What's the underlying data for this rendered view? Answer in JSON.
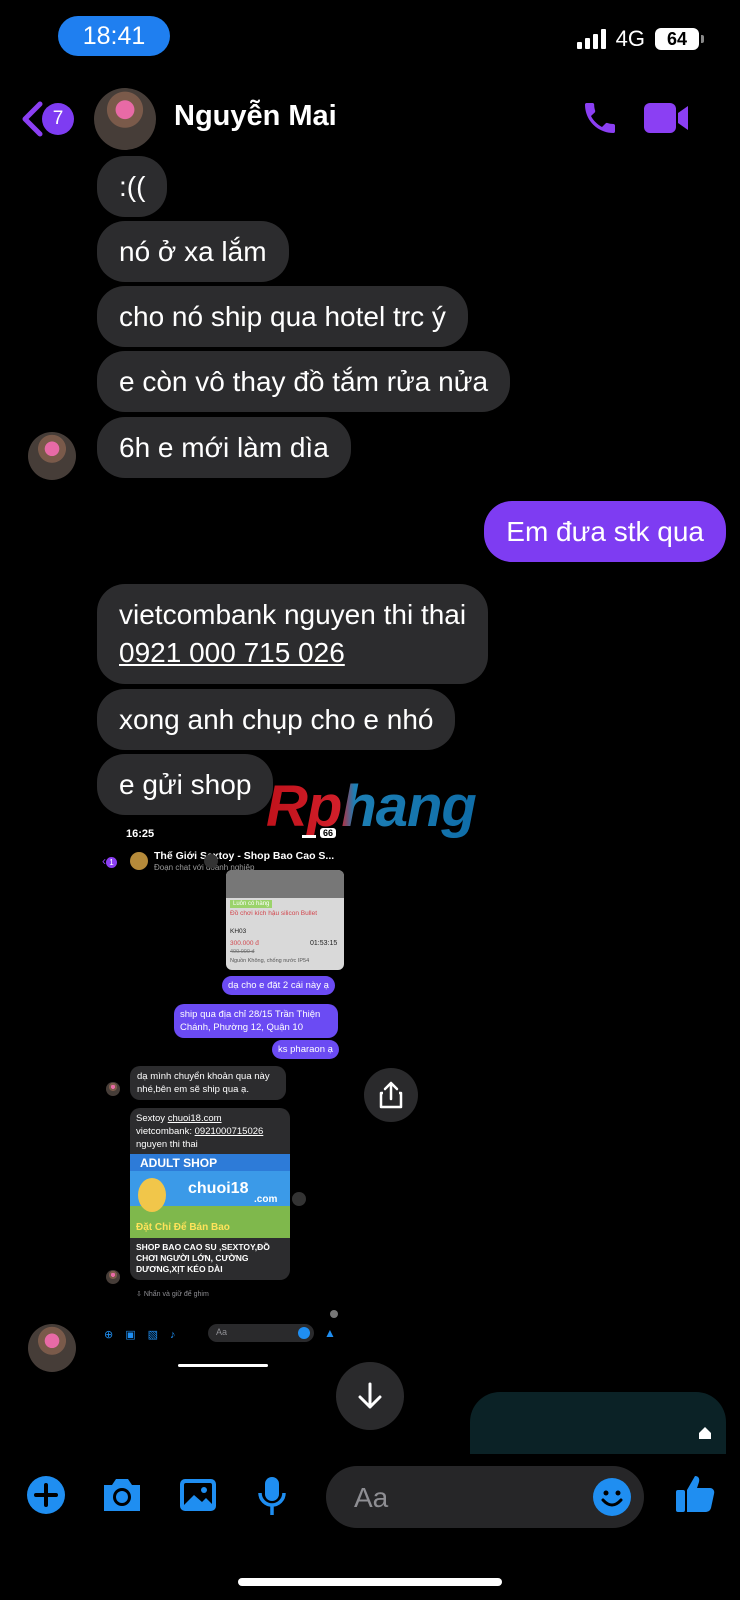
{
  "status_bar": {
    "time": "18:41",
    "network": "4G",
    "battery": "64"
  },
  "header": {
    "back_count": "7",
    "contact_name": "Nguyễn Mai"
  },
  "messages": [
    {
      "text": ":(("
    },
    {
      "text": "nó ở xa lắm"
    },
    {
      "text": "cho nó ship qua hotel trc ý"
    },
    {
      "text": "e còn vô thay đồ tắm rửa nửa"
    },
    {
      "text": "6h e mới làm dìa"
    },
    {
      "text": "Em đưa stk qua"
    },
    {
      "text": "vietcombank nguyen thi thai",
      "link": "0921 000 715 026"
    },
    {
      "text": "xong anh chụp cho e nhó"
    },
    {
      "text": "e gửi shop"
    }
  ],
  "watermark": "Rphang",
  "embedded": {
    "time": "16:25",
    "battery": "66",
    "back_count": "1",
    "title": "Thế Giới Sextoy - Shop Bao Cao S...",
    "subtitle": "Đoạn chat với doanh nghiệp",
    "product_tag": "Luôn có hàng",
    "product_name": "Đồ chơi kích hậu silicon Bullet",
    "product_code": "KH03",
    "price": "300.000 đ",
    "old_price": "400.000 đ",
    "product_time": "01:53:15",
    "product_note": "Nguồn Không, chống nước IP54",
    "msg_out_1": "dạ cho e đặt 2 cái này ạ",
    "msg_out_2": "ship qua địa chỉ 28/15 Trần Thiện Chánh, Phường 12, Quận 10",
    "msg_out_3": "ks pharaon ạ",
    "msg_in_1": "dạ mình chuyển khoản qua này nhé,bên em sẽ ship qua ạ.",
    "msg_in_2_line1": "Sextoy ",
    "msg_in_2_link1": "chuoi18.com",
    "msg_in_2_line2": "vietcombank: ",
    "msg_in_2_link2": "0921000715026",
    "msg_in_2_line3": "nguyen thi thai",
    "banner_top": "ADULT SHOP",
    "banner_mid": "chuoi18",
    "banner_com": ".com",
    "banner_bottom": "Đặt Chỉ Để Bán Bao",
    "shop_caption": "SHOP BAO CAO SU ,SEXTOY,ĐỒ CHƠI NGƯỜI LỚN, CƯỜNG DƯƠNG,XỊT KÉO DÀI",
    "pin_hint": "Nhấn và giữ để ghim",
    "input_placeholder": "Aa"
  },
  "composer": {
    "placeholder": "Aa"
  },
  "colors": {
    "accent": "#7e3cf2",
    "bubble_in": "#2c2c2e",
    "icon_blue": "#1f8ef1",
    "status_pill": "#1f7ff0"
  }
}
